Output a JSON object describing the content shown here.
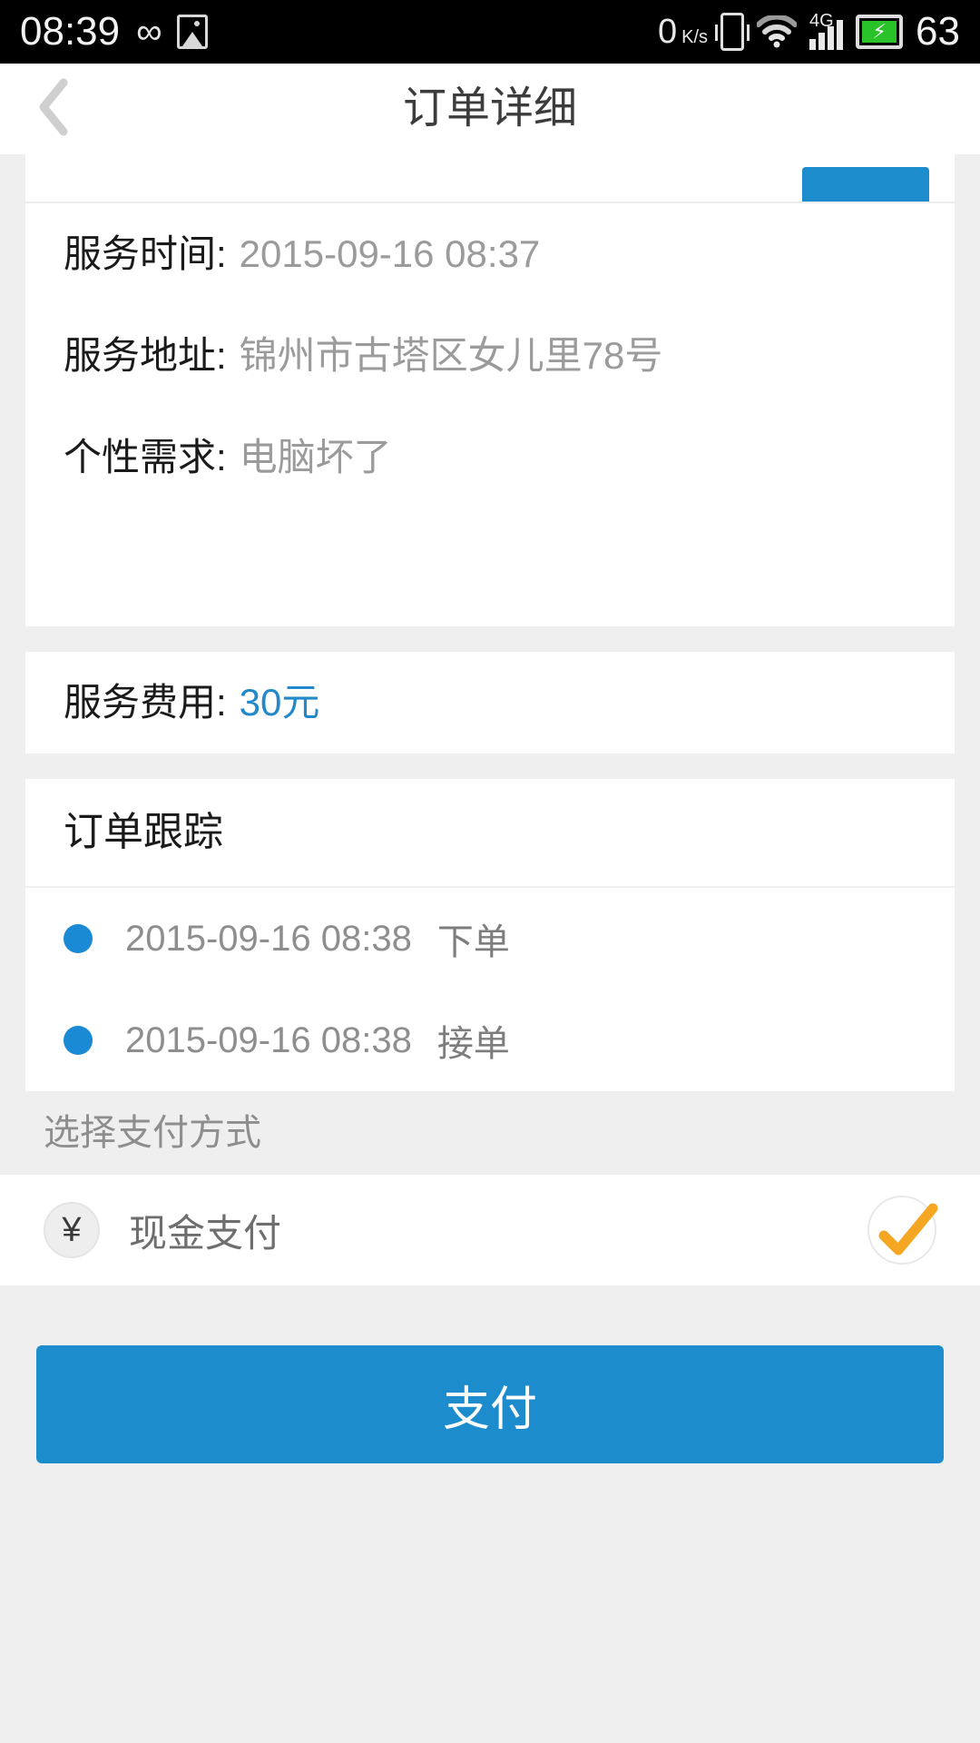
{
  "status_bar": {
    "time": "08:39",
    "infinity_icon": "infinity-icon",
    "photo_icon": "photo-icon",
    "net_speed": "0",
    "net_speed_unit": "K/s",
    "vibrate_icon": "vibrate-icon",
    "wifi_icon": "wifi-icon",
    "network_type": "4G",
    "signal_icon": "signal-bars-icon",
    "battery_icon": "battery-charging-icon",
    "battery_level": "63"
  },
  "navbar": {
    "back_icon": "chevron-left-icon",
    "title": "订单详细"
  },
  "order_info": {
    "rows": [
      {
        "label": "服务时间:",
        "value": "2015-09-16 08:37"
      },
      {
        "label": "服务地址:",
        "value": "锦州市古塔区女儿里78号"
      },
      {
        "label": "个性需求:",
        "value": "电脑坏了"
      }
    ],
    "fee_label": "服务费用:",
    "fee_value": "30元"
  },
  "order_tracking": {
    "title": "订单跟踪",
    "entries": [
      {
        "time": "2015-09-16 08:38",
        "status": "下单"
      },
      {
        "time": "2015-09-16 08:38",
        "status": "接单"
      }
    ]
  },
  "payment": {
    "hint": "选择支付方式",
    "method_icon": "yen-icon",
    "method_icon_glyph": "¥",
    "method_label": "现金支付",
    "selected_icon": "check-icon",
    "submit_label": "支付"
  },
  "colors": {
    "accent_blue": "#1c8ccd",
    "dot_blue": "#1a8ad4",
    "price_blue": "#2489c8",
    "check_orange": "#f5a623",
    "battery_green": "#29c229",
    "page_bg": "#efeff0"
  }
}
